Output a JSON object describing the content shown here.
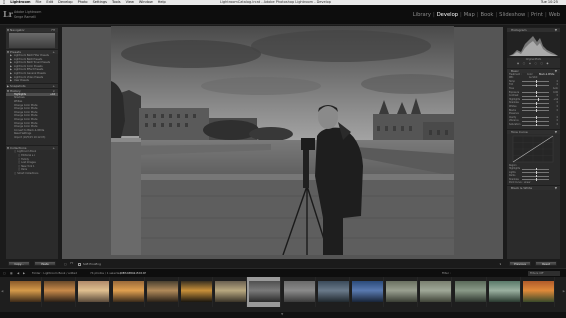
{
  "menubar": {
    "apple": "",
    "items": [
      "Lightroom",
      "File",
      "Edit",
      "Develop",
      "Photo",
      "Settings",
      "Tools",
      "View",
      "Window",
      "Help"
    ],
    "window_title": "LightroomCatalog.lrcat - Adobe Photoshop Lightroom - Develop",
    "clock": "Tue 10:25"
  },
  "header": {
    "logo": "Lr",
    "identity_line1": "Adobe Lightroom",
    "identity_line2": "Serge Ramelli",
    "modules": [
      "Library",
      "Develop",
      "Map",
      "Book",
      "Slideshow",
      "Print",
      "Web"
    ],
    "active_module": "Develop"
  },
  "left_panel": {
    "navigator": {
      "title": "Navigator",
      "zoom": "FIT"
    },
    "presets": {
      "title": "Presets",
      "items": [
        "Lightroom B&W Filter Presets",
        "Lightroom B&W Presets",
        "Lightroom B&W Toned Presets",
        "Lightroom Color Presets",
        "Lightroom Effect Presets",
        "Lightroom General Presets",
        "Lightroom Video Presets",
        "User Presets"
      ]
    },
    "snapshots": {
      "title": "Snapshots"
    },
    "history": {
      "title": "History",
      "items": [
        {
          "label": "Highlights",
          "value": "+16",
          "selected": true
        },
        {
          "label": "Shadows",
          "value": ""
        },
        {
          "label": "Whites",
          "value": ""
        },
        {
          "label": "Change Color Mode",
          "value": ""
        },
        {
          "label": "Change Color Mode",
          "value": ""
        },
        {
          "label": "Change Color Mode",
          "value": ""
        },
        {
          "label": "Change Color Mode",
          "value": ""
        },
        {
          "label": "Change Color Mode",
          "value": ""
        },
        {
          "label": "Change Color Mode",
          "value": ""
        },
        {
          "label": "Change Color Mode",
          "value": ""
        },
        {
          "label": "Convert to Black & White",
          "value": ""
        },
        {
          "label": "Reset Settings",
          "value": ""
        },
        {
          "label": "Import (10/5/15 10:12:03)",
          "value": ""
        }
      ]
    },
    "collections": {
      "title": "Collections",
      "items": [
        "Lightroom Book",
        "Editorial s.c",
        "Family",
        "Lost Images",
        "New York 1",
        "Paris",
        "Smart Collections"
      ]
    },
    "copy_button": "Copy...",
    "paste_button": "Paste"
  },
  "toolbar": {
    "soft_proofing": "Soft Proofing"
  },
  "right_panel": {
    "histogram_label": "Histogram",
    "original_photo": "Original Photo",
    "basic_title": "Basic",
    "treatment_label": "Treatment :",
    "treatment_options": [
      "Color",
      "Black & White"
    ],
    "wb_label": "WB :",
    "wb_value": "As Shot",
    "sliders": [
      {
        "label": "Temp",
        "value": "0",
        "pos": 0.5
      },
      {
        "label": "Tint",
        "value": "0",
        "pos": 0.5
      },
      {
        "label": "Tone",
        "value": "Auto",
        "pos": -1
      },
      {
        "label": "Exposure",
        "value": "0.00",
        "pos": 0.5
      },
      {
        "label": "Contrast",
        "value": "0",
        "pos": 0.5
      },
      {
        "label": "Highlights",
        "value": "+16",
        "pos": 0.58
      },
      {
        "label": "Shadows",
        "value": "0",
        "pos": 0.5
      },
      {
        "label": "Whites",
        "value": "0",
        "pos": 0.5
      },
      {
        "label": "Blacks",
        "value": "0",
        "pos": 0.5
      },
      {
        "label": "Presence",
        "value": "",
        "pos": -1
      },
      {
        "label": "Clarity",
        "value": "0",
        "pos": 0.5
      },
      {
        "label": "Vibrance",
        "value": "0",
        "pos": 0.5
      },
      {
        "label": "Saturation",
        "value": "0",
        "pos": 0.5
      }
    ],
    "tone_curve_title": "Tone Curve",
    "region": "Region",
    "tone_sliders": [
      "Highlights",
      "Lights",
      "Darks",
      "Shadows"
    ],
    "point_curve": "Point Curve : Linear",
    "bw_title": "Black & White",
    "previous_button": "Previous",
    "reset_button": "Reset"
  },
  "statusbar": {
    "path": "Folder : Lightroom Book / edited",
    "count": "74 photos / 1 selected",
    "filename": "/0B7A8842-Edit.tif",
    "filter_label": "Filter :",
    "filter_value": "Filters Off"
  },
  "filmstrip": {
    "thumbs": [
      {
        "colors": [
          "#8a5a2a",
          "#d59a4a",
          "#3d2a18"
        ]
      },
      {
        "colors": [
          "#6a4a2a",
          "#c88a4a",
          "#2c2016"
        ]
      },
      {
        "colors": [
          "#b08a6a",
          "#e0c090",
          "#5a4a3a"
        ]
      },
      {
        "colors": [
          "#9a6a3a",
          "#e0a050",
          "#3a2a1a"
        ]
      },
      {
        "colors": [
          "#4a4030",
          "#b08a5a",
          "#2a2218"
        ]
      },
      {
        "colors": [
          "#3a3020",
          "#c8903a",
          "#1a160e"
        ]
      },
      {
        "colors": [
          "#6a6050",
          "#b8a880",
          "#3a3428"
        ]
      },
      {
        "colors": [
          "#505050",
          "#7a7a7a",
          "#2a2a2a"
        ]
      },
      {
        "colors": [
          "#6a6a6a",
          "#8a8a8a",
          "#3a3a3a"
        ]
      },
      {
        "colors": [
          "#3a4a5a",
          "#6a7a8a",
          "#20282e"
        ]
      },
      {
        "colors": [
          "#2a4a7a",
          "#5a7ab0",
          "#182438"
        ]
      },
      {
        "colors": [
          "#6a7060",
          "#9aa090",
          "#3a3e34"
        ]
      },
      {
        "colors": [
          "#7a8070",
          "#a0a898",
          "#404438"
        ]
      },
      {
        "colors": [
          "#5a6a5a",
          "#8a9a88",
          "#2e362e"
        ]
      },
      {
        "colors": [
          "#5a7a6a",
          "#9ab0a0",
          "#2a3a30"
        ]
      },
      {
        "colors": [
          "#b05a2a",
          "#e08a3a",
          "#3a4a2a"
        ]
      }
    ],
    "selected_index": 7
  }
}
